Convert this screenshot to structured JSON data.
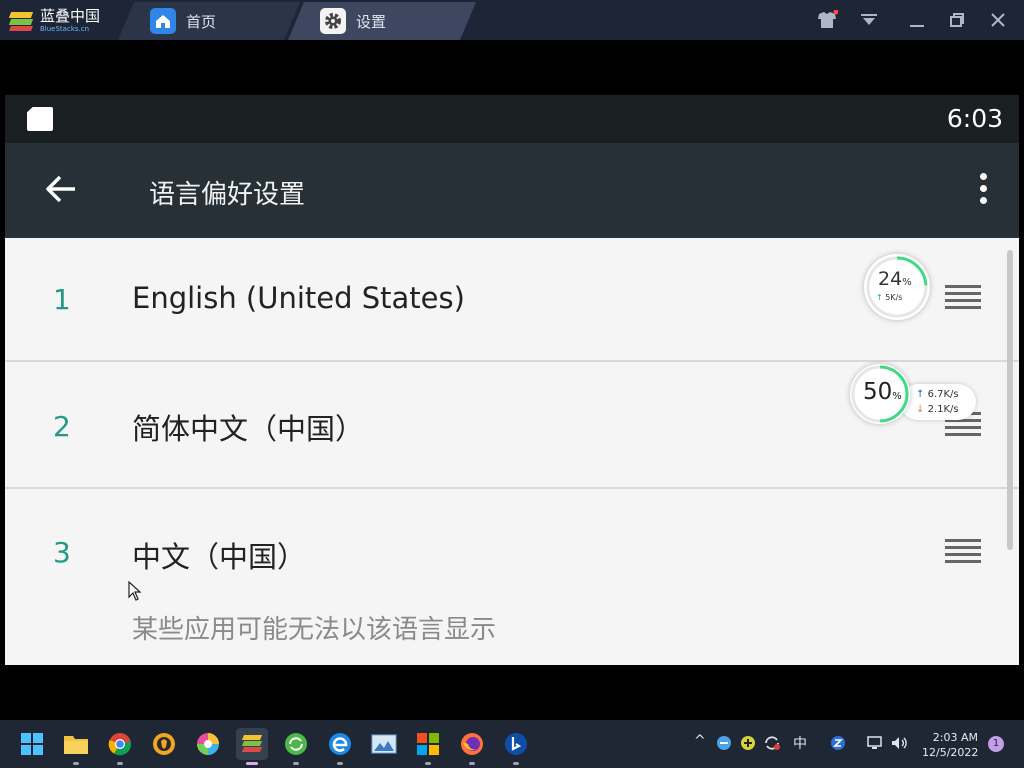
{
  "window": {
    "brand": "蓝叠中国",
    "brand_sub": "BlueStacks.cn",
    "tabs": [
      {
        "label": "首页"
      },
      {
        "label": "设置"
      }
    ]
  },
  "android": {
    "clock": "6:03",
    "appbar_title": "语言偏好设置",
    "languages": [
      {
        "num": "1",
        "name": "English (United States)",
        "note": ""
      },
      {
        "num": "2",
        "name": "简体中文（中国）",
        "note": ""
      },
      {
        "num": "3",
        "name": "中文（中国）",
        "note": "某些应用可能无法以该语言显示"
      }
    ]
  },
  "widgets": {
    "gauge_small": {
      "value": "24",
      "unit": "%",
      "speed": "5K/s",
      "fraction": 0.24
    },
    "gauge_large": {
      "value": "50",
      "unit": "%",
      "up": "6.7",
      "down": "2.1",
      "speed_unit": "K/s",
      "fraction": 0.5
    }
  },
  "taskbar": {
    "ime": "中",
    "time": "2:03 AM",
    "date": "12/5/2022",
    "notifications": "1"
  },
  "colors": {
    "accent_teal": "#229a86",
    "appbar": "#263036",
    "gauge_green": "#3ddc84"
  }
}
